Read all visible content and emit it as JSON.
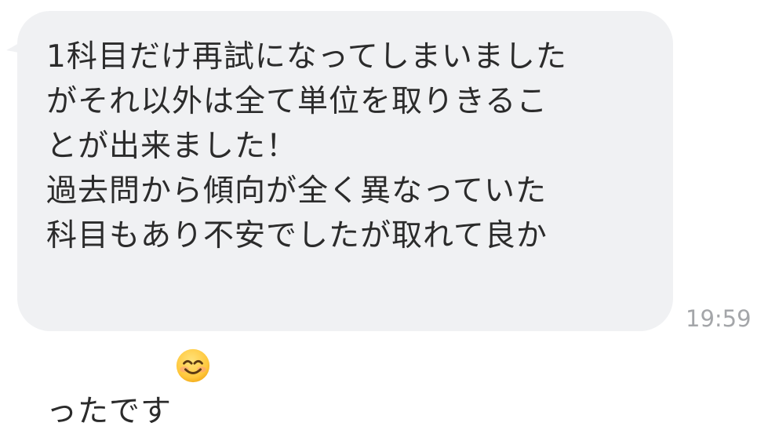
{
  "message": {
    "lines": [
      "1科目だけ再試になってしまいました",
      "がそれ以外は全て単位を取りきるこ",
      "とが出来ました！",
      "過去問から傾向が全く異なっていた",
      "科目もあり不安でしたが取れて良か",
      "ったです"
    ],
    "emoji_icon": "smiling-face-with-smiling-eyes-emoji",
    "timestamp": "19:59",
    "colors": {
      "bubble_background": "#f0f1f3",
      "text": "#2b2b2b",
      "timestamp": "#a4a6a9",
      "emoji_face": "#ffc83d"
    }
  }
}
